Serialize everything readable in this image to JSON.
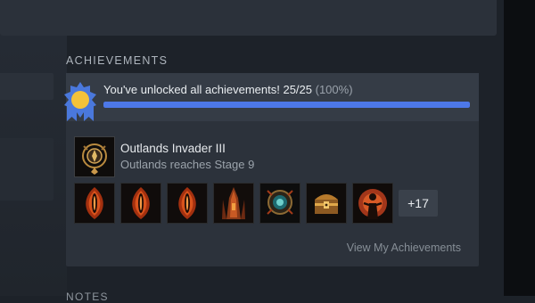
{
  "section": {
    "title": "ACHIEVEMENTS"
  },
  "next_section": {
    "title": "NOTES"
  },
  "progress": {
    "text": "You've unlocked all achievements! 25/25",
    "percent_text": "(100%)",
    "unlocked": 25,
    "total": 25,
    "fraction": 1.0
  },
  "recent": {
    "name": "Outlands Invader III",
    "description": "Outlands reaches Stage 9",
    "icon": "ornate-gold-medallion-icon"
  },
  "achievement_icons": [
    "flame-eye-icon",
    "flame-eye-icon",
    "flame-eye-icon",
    "spired-tower-icon",
    "teal-gem-icon",
    "treasure-chest-icon",
    "dark-silhouette-icon"
  ],
  "more_count": "+17",
  "view_link": "View My Achievements",
  "colors": {
    "accent": "#4d78e8",
    "badge_blue": "#4a78dc",
    "badge_gold": "#f4c23a"
  }
}
